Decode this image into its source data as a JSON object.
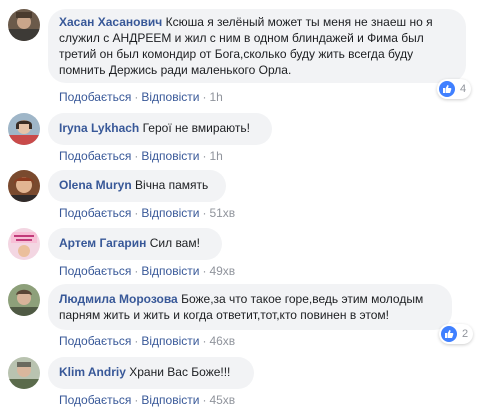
{
  "colors": {
    "link": "#385898",
    "bubble": "#f2f3f5",
    "meta": "#90949c",
    "like": "#4080ff"
  },
  "comments": [
    {
      "author": "Хасан Хасанович",
      "text_lines": [
        "Ксюша я зелёный может ты меня не знаеш но я",
        "служил с АНДРЕЕМ и жил с ним в одном блиндажей и Фима был",
        "третий он был комондир от Бога,сколько буду жить всегда буду",
        "помнить Держись ради маленького Орла."
      ],
      "like_label": "Подобається",
      "reply_label": "Відповісти",
      "time": "1h",
      "reactions": {
        "icon": "like-icon",
        "count": "4"
      }
    },
    {
      "author": "Iryna Lykhach",
      "text": "Герої не вмирають!",
      "like_label": "Подобається",
      "reply_label": "Відповісти",
      "time": "1h"
    },
    {
      "author": "Olena Muryn",
      "text": "Вічна память",
      "like_label": "Подобається",
      "reply_label": "Відповісти",
      "time": "51хв"
    },
    {
      "author": "Артем Гагарин",
      "text": "Сил вам!",
      "like_label": "Подобається",
      "reply_label": "Відповісти",
      "time": "49хв"
    },
    {
      "author": "Людмила Морозова",
      "text_lines": [
        "Боже,за что такое горе,ведь этим молодым",
        "парням жить и жить и когда ответит,тот,кто повинен в этом!"
      ],
      "like_label": "Подобається",
      "reply_label": "Відповісти",
      "time": "46хв",
      "reactions": {
        "icon": "like-icon",
        "count": "2"
      }
    },
    {
      "author": "Klim Andriy",
      "text": "Храни Вас Боже!!!",
      "like_label": "Подобається",
      "reply_label": "Відповісти",
      "time": "45хв"
    }
  ]
}
